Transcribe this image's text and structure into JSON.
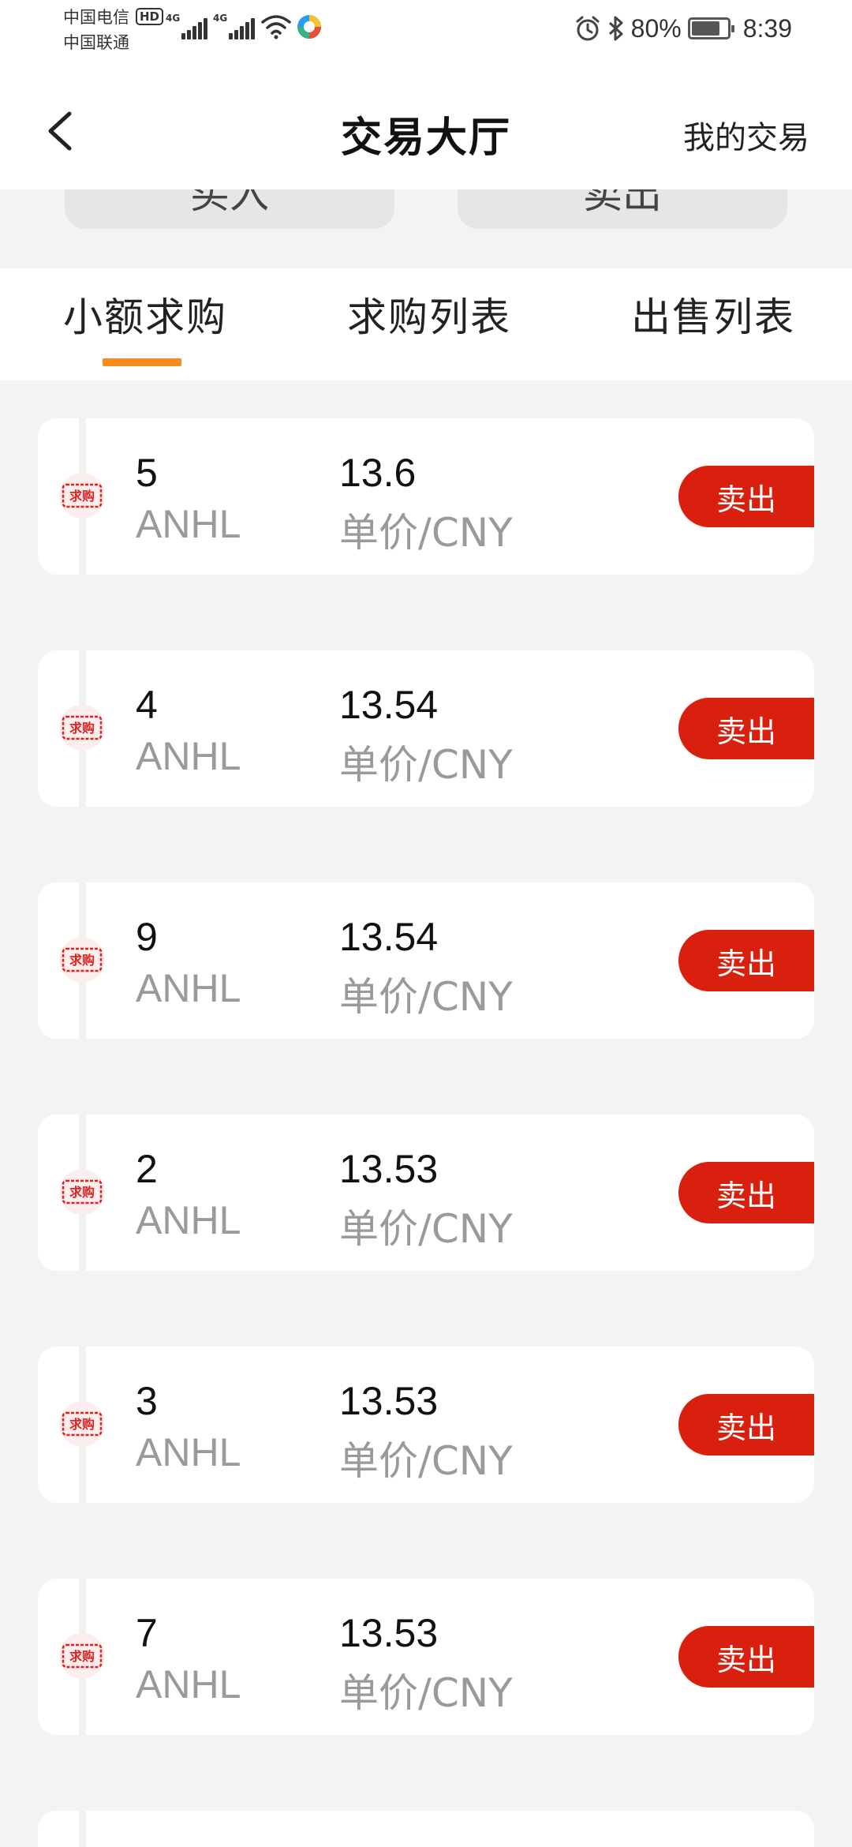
{
  "status_bar": {
    "carrier_1": "中国电信",
    "carrier_2": "中国联通",
    "hd": "HD",
    "network_1": "4G",
    "network_2": "4G",
    "battery_percent": "80%",
    "battery_level": 0.8,
    "time": "8:39"
  },
  "header": {
    "title": "交易大厅",
    "right_link": "我的交易"
  },
  "top_buttons": [
    {
      "label": "买入"
    },
    {
      "label": "卖出"
    }
  ],
  "tabs": [
    {
      "label": "小额求购",
      "active": true
    },
    {
      "label": "求购列表",
      "active": false
    },
    {
      "label": "出售列表",
      "active": false
    }
  ],
  "orders": [
    {
      "badge": "求购",
      "quantity": "5",
      "unit": "ANHL",
      "price": "13.6",
      "price_unit": "单价/CNY",
      "action": "卖出"
    },
    {
      "badge": "求购",
      "quantity": "4",
      "unit": "ANHL",
      "price": "13.54",
      "price_unit": "单价/CNY",
      "action": "卖出"
    },
    {
      "badge": "求购",
      "quantity": "9",
      "unit": "ANHL",
      "price": "13.54",
      "price_unit": "单价/CNY",
      "action": "卖出"
    },
    {
      "badge": "求购",
      "quantity": "2",
      "unit": "ANHL",
      "price": "13.53",
      "price_unit": "单价/CNY",
      "action": "卖出"
    },
    {
      "badge": "求购",
      "quantity": "3",
      "unit": "ANHL",
      "price": "13.53",
      "price_unit": "单价/CNY",
      "action": "卖出"
    },
    {
      "badge": "求购",
      "quantity": "7",
      "unit": "ANHL",
      "price": "13.53",
      "price_unit": "单价/CNY",
      "action": "卖出"
    }
  ],
  "colors": {
    "accent": "#f68b1f",
    "sell": "#d9200e",
    "background": "#f3f3f3"
  }
}
